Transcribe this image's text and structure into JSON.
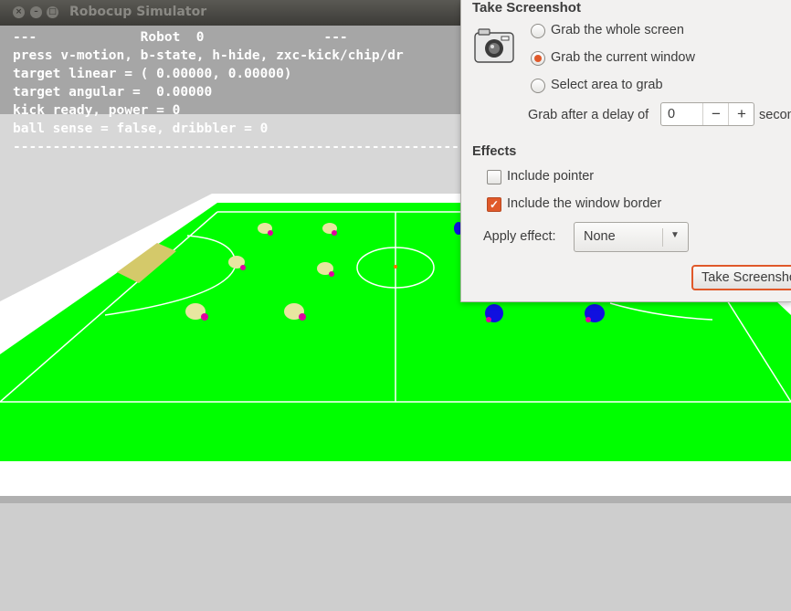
{
  "window": {
    "title": "Robocup Simulator",
    "buttons": {
      "close": "×",
      "minimize": "–",
      "maximize": "□"
    }
  },
  "hud": {
    "lines": [
      "---             Robot  0               ---",
      "press v-motion, b-state, h-hide, zxc-kick/chip/dr",
      "target linear = ( 0.00000, 0.00000)",
      "target angular =  0.00000",
      "kick ready, power = 0",
      "ball sense = false, dribbler = 0",
      "----------------------------------------------------------------------"
    ]
  },
  "scene": {
    "colors": {
      "sky": "#a6a6a6",
      "wall": "#d7d7d7",
      "grass": "#00ff00",
      "border": "#ffffff",
      "yellow_team": "#e8e6a0",
      "blue_team": "#1010e0",
      "marker": "#e000a0"
    }
  },
  "dialog": {
    "title": "Take Screenshot",
    "icon": "camera-icon",
    "options": [
      {
        "label": "Grab the whole screen",
        "checked": false
      },
      {
        "label": "Grab the current window",
        "checked": true
      },
      {
        "label": "Select area to grab",
        "checked": false
      }
    ],
    "delay": {
      "label": "Grab after a delay of",
      "value": "0",
      "minus": "−",
      "plus": "+",
      "unit": "seconds"
    },
    "effects": {
      "heading": "Effects",
      "include_pointer": {
        "label": "Include pointer",
        "checked": false
      },
      "include_border": {
        "label": "Include the window border",
        "checked": true
      },
      "apply_effect_label": "Apply effect:",
      "apply_effect_value": "None"
    },
    "take_button": "Take Screenshot",
    "accent": "#e0592a"
  }
}
